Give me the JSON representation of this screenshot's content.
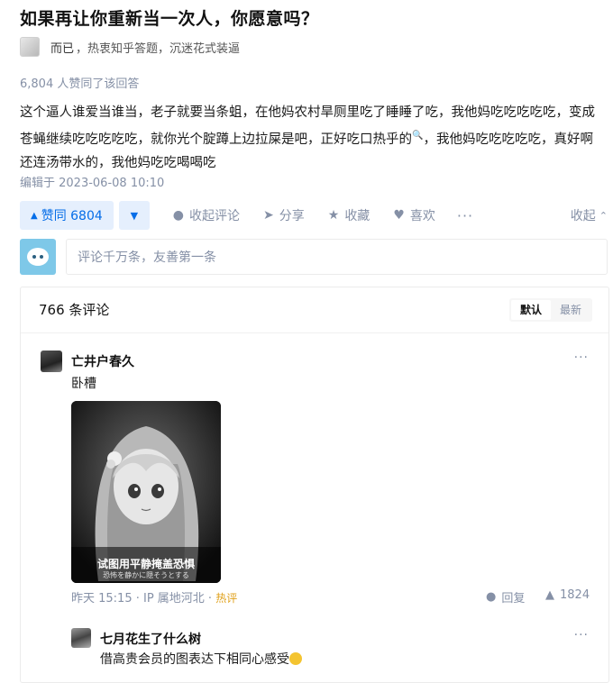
{
  "question": {
    "title": "如果再让你重新当一次人，你愿意吗？"
  },
  "author": {
    "name": "而已",
    "bio": "，热衷知乎答题，沉迷花式装逼"
  },
  "answer": {
    "upvote_line": "6,804 人赞同了该回答",
    "body_part1": "这个逼人谁爱当谁当，老子就要当条蛆，在他妈农村旱厕里吃了睡睡了吃，我他妈吃吃吃吃吃，变成苍蝇继续吃吃吃吃吃，就你光个腚蹲上边拉屎是吧，正好吃口",
    "hot_link": "热乎的",
    "body_part2": "，我他妈吃吃吃吃吃，真好啊还连汤带水的，我他妈吃吃喝喝吃",
    "edit_time": "编辑于 2023-06-08 10:10"
  },
  "actions": {
    "upvote_label": "赞同 6804",
    "collapse_comments": "收起评论",
    "share": "分享",
    "favorite": "收藏",
    "like": "喜欢",
    "more": "···",
    "collapse": "收起"
  },
  "comment_input": {
    "placeholder": "评论千万条，友善第一条"
  },
  "comments": {
    "count_label": "766 条评论",
    "sort_default": "默认",
    "sort_latest": "最新",
    "items": [
      {
        "author": "亡井户春久",
        "text": "卧槽",
        "image_caption_main": "试图用平静掩盖恐惧",
        "image_caption_sub": "恐怖を静かに隠そうとする",
        "meta": "昨天 15:15 · IP 属地河北 · ",
        "hot_tag": "热评",
        "reply_label": "回复",
        "like_count": "1824"
      },
      {
        "author": "七月花生了什么树",
        "text": "借高贵会员的图表达下相同心感受"
      }
    ]
  },
  "colors": {
    "accent": "#056de8",
    "accent_bg": "#e5effd",
    "muted": "#8590a6",
    "hot": "#e0a11b"
  }
}
